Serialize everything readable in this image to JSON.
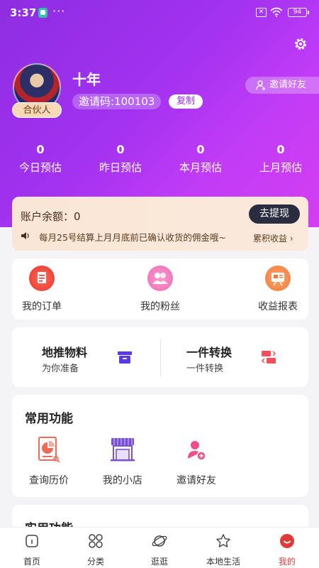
{
  "status_bar": {
    "time": "3:37",
    "dots": "···",
    "sim": "✕",
    "battery": "94"
  },
  "profile": {
    "username": "十年",
    "badge": "合伙人",
    "invite_code": "邀请码:100103",
    "copy_label": "复制",
    "invite_friends_label": "邀请好友"
  },
  "stats": [
    {
      "value": "0",
      "label": "今日预估"
    },
    {
      "value": "0",
      "label": "昨日预估"
    },
    {
      "value": "0",
      "label": "本月预估"
    },
    {
      "value": "0",
      "label": "上月预估"
    }
  ],
  "balance": {
    "label": "账户余额：0",
    "withdraw_label": "去提现",
    "notice": "每月25号结算上月月底前已确认收货的佣金哦~",
    "accumulated_label": "累积收益 ›"
  },
  "quick_links": [
    {
      "label": "我的订单",
      "icon": "order-doc-icon"
    },
    {
      "label": "我的粉丝",
      "icon": "fans-icon"
    },
    {
      "label": "收益报表",
      "icon": "report-icon"
    }
  ],
  "promo": {
    "left_title": "地推物料",
    "left_sub": "为你准备",
    "right_title": "一件转换",
    "right_sub": "一件转换"
  },
  "common": {
    "heading": "常用功能",
    "items": [
      {
        "label": "查询历价",
        "icon": "price-history-icon"
      },
      {
        "label": "我的小店",
        "icon": "shop-icon"
      },
      {
        "label": "邀请好友",
        "icon": "invite-user-icon"
      }
    ]
  },
  "practical": {
    "heading": "实用功能"
  },
  "tabbar": [
    {
      "label": "首页",
      "icon": "home-icon"
    },
    {
      "label": "分类",
      "icon": "category-icon"
    },
    {
      "label": "逛逛",
      "icon": "planet-icon"
    },
    {
      "label": "本地生活",
      "icon": "star-icon"
    },
    {
      "label": "我的",
      "icon": "profile-icon"
    }
  ],
  "colors": {
    "accent": "#a332f0",
    "active_tab": "#e03b3b",
    "dark_button": "#2a2c3f"
  }
}
